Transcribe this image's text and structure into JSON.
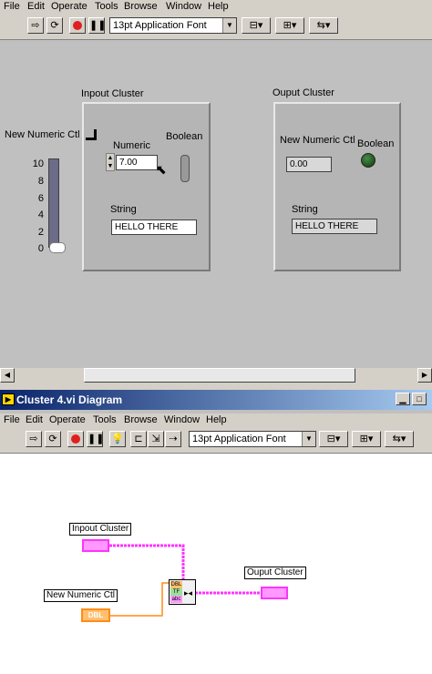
{
  "front_panel": {
    "menu": [
      "File",
      "Edit",
      "Operate",
      "Tools",
      "Browse",
      "Window",
      "Help"
    ],
    "font_selector": "13pt Application Font",
    "input_cluster": {
      "title": "Inpout Cluster",
      "numeric_label": "Numeric",
      "numeric_value": "7.00",
      "boolean_label": "Boolean",
      "string_label": "String",
      "string_value": "HELLO THERE"
    },
    "output_cluster": {
      "title": "Ouput Cluster",
      "numeric_label": "New Numeric Ctl",
      "numeric_value": "0.00",
      "boolean_label": "Boolean",
      "string_label": "String",
      "string_value": "HELLO THERE"
    },
    "slider": {
      "label": "New Numeric Ctl",
      "ticks": [
        "10",
        "8",
        "6",
        "4",
        "2",
        "0"
      ],
      "value": 0
    }
  },
  "diagram_window": {
    "title": "Cluster 4.vi Diagram",
    "menu": [
      "File",
      "Edit",
      "Operate",
      "Tools",
      "Browse",
      "Window",
      "Help"
    ],
    "font_selector": "13pt Application Font",
    "terminals": {
      "input_cluster": "Inpout Cluster",
      "new_numeric": "New Numeric Ctl",
      "new_numeric_type": "DBL",
      "output_cluster": "Ouput Cluster",
      "bundle_slots": [
        "DBL",
        "TF",
        "abc"
      ]
    }
  },
  "colors": {
    "cluster_wire": "#ff33ff",
    "numeric_wire": "#ff8c1a",
    "titlebar": "#0a246a"
  }
}
